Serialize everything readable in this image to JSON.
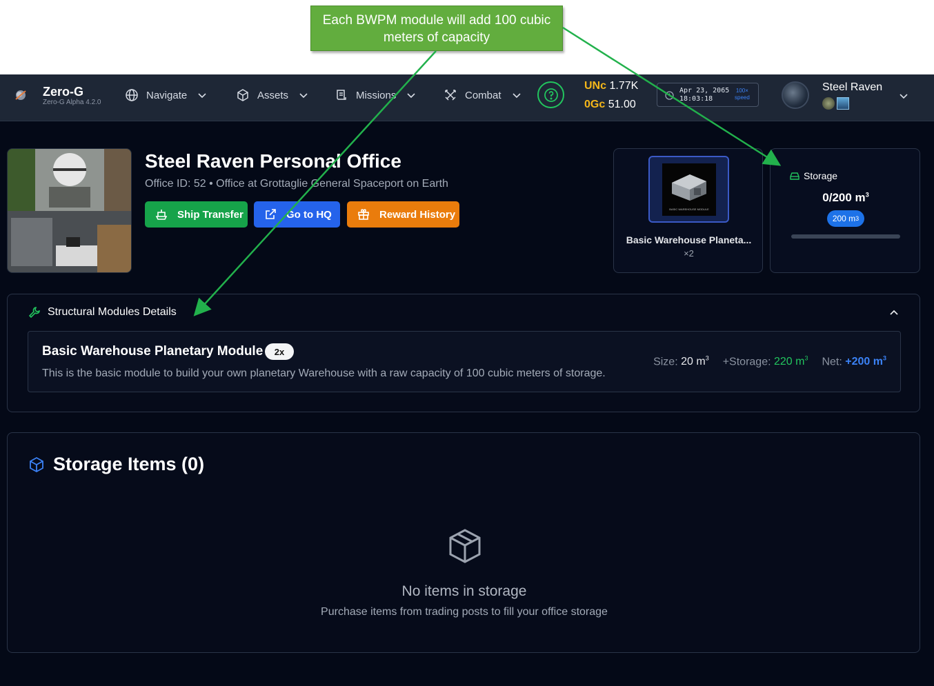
{
  "annotation": {
    "text": "Each BWPM module will add 100 cubic meters of capacity"
  },
  "nav": {
    "brand_name": "Zero-G",
    "brand_version": "Zero-G Alpha 4.2.0",
    "items": [
      {
        "label": "Navigate",
        "icon": "globe-icon"
      },
      {
        "label": "Assets",
        "icon": "cube-icon"
      },
      {
        "label": "Missions",
        "icon": "scroll-icon"
      },
      {
        "label": "Combat",
        "icon": "crossed-swords-icon"
      }
    ],
    "unc_label": "UNc",
    "unc_value": "1.77K",
    "ogc_label": "0Gc",
    "ogc_value": "51.00",
    "clock_date": "Apr 23, 2065\n18:03:18",
    "clock_speed": "100×\nspeed",
    "username": "Steel Raven"
  },
  "office": {
    "title": "Steel Raven Personal Office",
    "subtitle": "Office ID: 52 • Office at Grottaglie General Spaceport on Earth",
    "buttons": {
      "ship_transfer": "Ship Transfer",
      "go_to_hq": "Go to HQ",
      "reward_history": "Reward History"
    }
  },
  "module_card": {
    "name": "Basic Warehouse Planeta...",
    "quantity": "×2",
    "thumb_caption": "BASIC WAREHOUSE MODULE"
  },
  "storage_card": {
    "label": "Storage",
    "value": "0/200 m",
    "capacity_pill": "200 m",
    "fill_fraction": 0
  },
  "structural": {
    "heading": "Structural Modules Details",
    "module_name": "Basic Warehouse Planetary Module",
    "module_count": "2x",
    "description": "This is the basic module to build your own planetary Warehouse with a raw capacity of 100 cubic meters of storage.",
    "size_label": "Size:",
    "size_value": "20 m",
    "storage_label": "+Storage:",
    "storage_value": "220 m",
    "net_label": "Net:",
    "net_value": "+200 m"
  },
  "storage_items": {
    "heading": "Storage Items (0)",
    "empty_title": "No items in storage",
    "empty_subtitle": "Purchase items from trading posts to fill your office storage"
  },
  "colors": {
    "background": "#040917",
    "nav": "#1e2736",
    "green": "#16a34a",
    "blue": "#2563eb",
    "orange": "#ea7c0c",
    "callout": "#62ad3e",
    "gold": "#f5b71a"
  }
}
